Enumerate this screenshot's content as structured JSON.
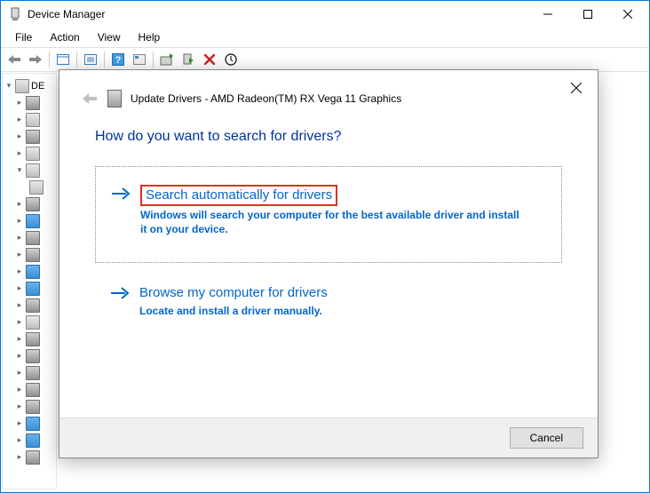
{
  "window": {
    "title": "Device Manager"
  },
  "menu": {
    "file": "File",
    "action": "Action",
    "view": "View",
    "help": "Help"
  },
  "tree": {
    "root": "DE"
  },
  "dialog": {
    "title": "Update Drivers - AMD Radeon(TM) RX Vega 11 Graphics",
    "question": "How do you want to search for drivers?",
    "opt1": {
      "title": "Search automatically for drivers",
      "desc": "Windows will search your computer for the best available driver and install it on your device."
    },
    "opt2": {
      "title": "Browse my computer for drivers",
      "desc": "Locate and install a driver manually."
    },
    "cancel": "Cancel"
  }
}
